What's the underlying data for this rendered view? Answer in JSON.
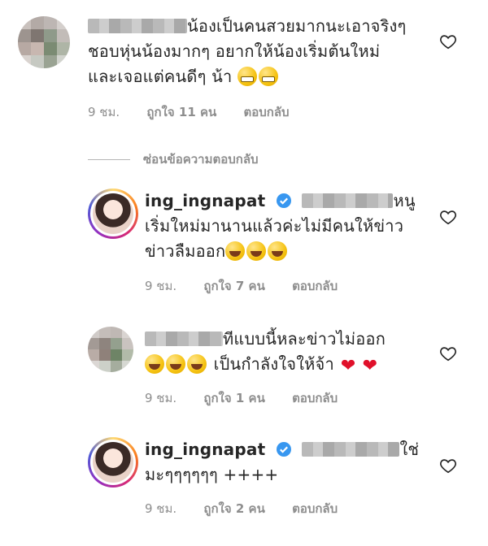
{
  "comments": [
    {
      "username": "",
      "text_lines": [
        "น้องเป็นคนสวยมากนะเอาจริงๆ",
        "ชอบหุ่นน้องมากๆ  อยากให้น้องเริ่มต้นใหม่",
        "และเจอแต่คนดีๆ น้า"
      ],
      "time": "9 ชม.",
      "likes": "ถูกใจ 11 คน",
      "reply": "ตอบกลับ"
    },
    {
      "username": "ing_ingnapat",
      "text_lines": [
        "หนู",
        "เริ่มใหม่มานานแล้วค่ะไม่มีคนให้ข่าว",
        "ข่าวลืมออก"
      ],
      "time": "9 ชม.",
      "likes": "ถูกใจ 7 คน",
      "reply": "ตอบกลับ"
    },
    {
      "username": "",
      "text_lines": [
        "ทีแบบนี้หละข่าวไม่ออก",
        "เป็นกำลังใจให้จ้า"
      ],
      "time": "9 ชม.",
      "likes": "ถูกใจ 1 คน",
      "reply": "ตอบกลับ"
    },
    {
      "username": "ing_ingnapat",
      "text_lines": [
        "ใช่",
        "มะๆๆๆๆๆๆ ++++"
      ],
      "time": "9 ชม.",
      "likes": "ถูกใจ 2 คน",
      "reply": "ตอบกลับ"
    }
  ],
  "hide_replies": "ซ่อนข้อความตอบกลับ",
  "icons": {
    "like": "heart-outline-icon",
    "verified": "verified-badge-icon"
  },
  "colors": {
    "verified": "#3897f0",
    "meta": "#8e8e8e",
    "text": "#262626"
  }
}
